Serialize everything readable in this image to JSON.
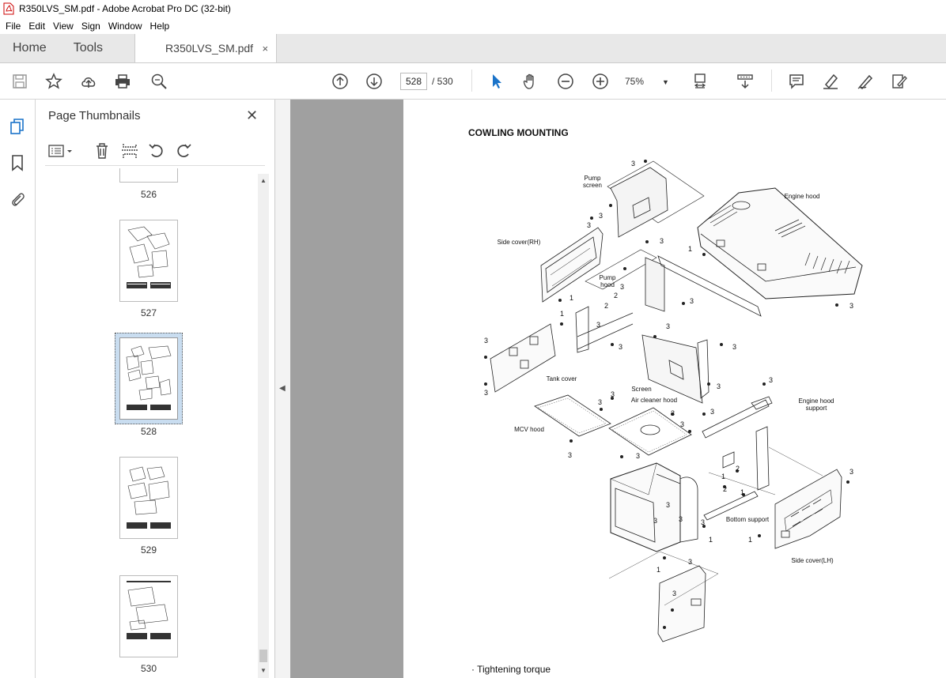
{
  "window": {
    "title": "R350LVS_SM.pdf - Adobe Acrobat Pro DC (32-bit)"
  },
  "menu": [
    "File",
    "Edit",
    "View",
    "Sign",
    "Window",
    "Help"
  ],
  "tabs": {
    "home": "Home",
    "tools": "Tools",
    "doc": "R350LVS_SM.pdf",
    "close": "×"
  },
  "nav": {
    "current_page": "528",
    "total": "/ 530",
    "zoom": "75%"
  },
  "panel": {
    "title": "Page Thumbnails",
    "close": "✕",
    "thumbnails": [
      {
        "label": "526"
      },
      {
        "label": "527"
      },
      {
        "label": "528"
      },
      {
        "label": "529"
      },
      {
        "label": "530"
      }
    ]
  },
  "document": {
    "title": "COWLING MOUNTING",
    "labels": {
      "pump_screen": "Pump screen",
      "engine_hood": "Engine hood",
      "side_cover_rh": "Side cover(RH)",
      "pump_hood": "Pump hood",
      "tank_cover": "Tank cover",
      "screen": "Screen",
      "air_cleaner_hood": "Air cleaner hood",
      "engine_hood_support": "Engine hood support",
      "mcv_hood": "MCV hood",
      "bottom_support": "Bottom support",
      "side_cover_lh": "Side cover(LH)"
    },
    "torque_note": "· Tightening torque"
  }
}
